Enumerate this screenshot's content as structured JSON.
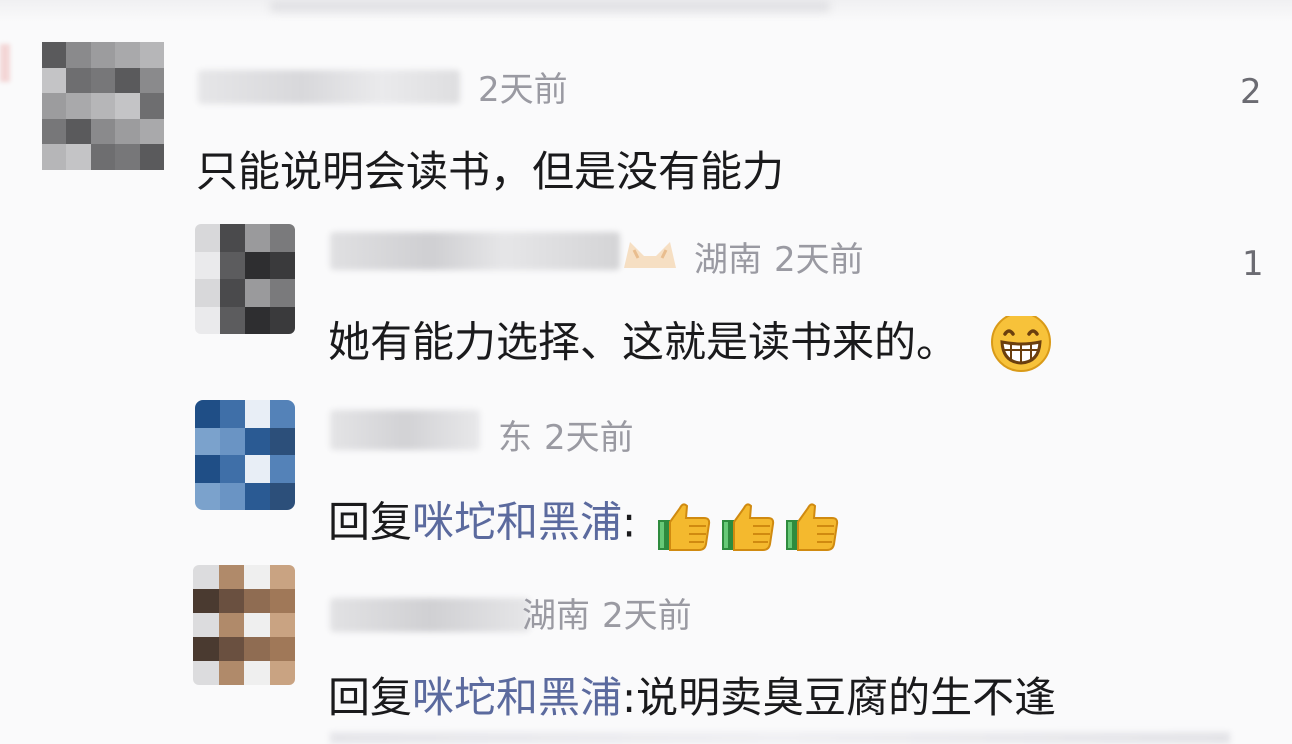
{
  "comments": [
    {
      "time": "2天前",
      "likes": "2",
      "text": "只能说明会读书，但是没有能力"
    },
    {
      "location": "湖南",
      "time": "2天前",
      "likes": "1",
      "text": "她有能力选择、这就是读书来的。"
    },
    {
      "location": "东",
      "time": "2天前",
      "reply_prefix": "回复",
      "reply_to": "咪坨和黑浦",
      "text": ":"
    },
    {
      "location": "湖南",
      "time": "2天前",
      "reply_prefix": "回复",
      "reply_to": "咪坨和黑浦",
      "text": ":说明卖臭豆腐的生不逢"
    }
  ],
  "icons": {
    "grin": "grinning-face-emoji",
    "thumbs": "thumbs-up-emoji",
    "cat": "cat-ears-emoji"
  },
  "colors": {
    "mention": "#5b6a9e",
    "meta": "#9a9aa2",
    "text": "#1a1a1c"
  }
}
